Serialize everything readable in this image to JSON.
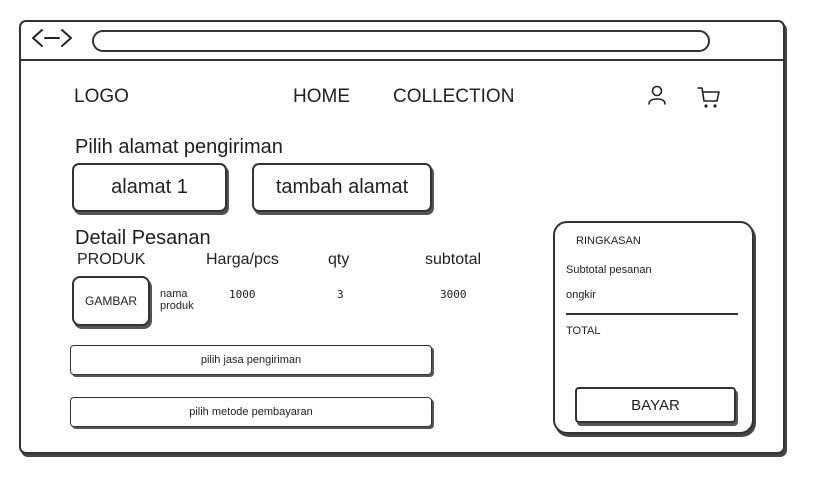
{
  "browser": {
    "back_forward_icon": "code-brackets-icon"
  },
  "header": {
    "logo": "LOGO",
    "nav": [
      "HOME",
      "COLLECTION"
    ],
    "icons": [
      "user-icon",
      "cart-icon"
    ]
  },
  "address": {
    "title": "Pilih alamat pengiriman",
    "option_1": "alamat 1",
    "add_label": "tambah alamat"
  },
  "order": {
    "title": "Detail Pesanan",
    "columns": [
      "PRODUK",
      "Harga/pcs",
      "qty",
      "subtotal"
    ],
    "item": {
      "image_label": "GAMBAR",
      "name_line1": "nama",
      "name_line2": "produk",
      "price": "1000",
      "qty": "3",
      "subtotal": "3000"
    },
    "shipping_button": "pilih jasa pengiriman",
    "payment_button": "pilih metode pembayaran"
  },
  "summary": {
    "title": "RINGKASAN",
    "subtotal_label": "Subtotal pesanan",
    "shipping_label": "ongkir",
    "total_label": "TOTAL",
    "pay_button": "BAYAR"
  }
}
